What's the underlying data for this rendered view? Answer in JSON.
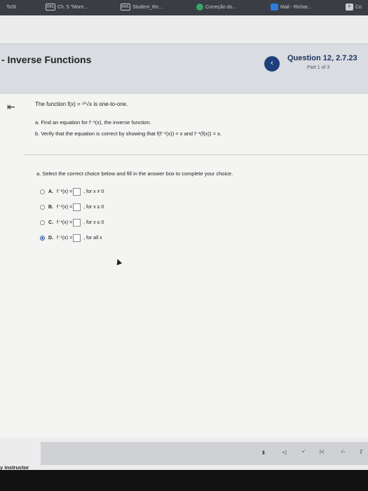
{
  "browser": {
    "tabs": [
      {
        "label": "ToSt",
        "icon": "tab-favicon"
      },
      {
        "label": "Ch. 5 \"More...",
        "icon": "mml-icon"
      },
      {
        "label": "Student_Re...",
        "icon": "mml-icon"
      },
      {
        "label": "Correção do...",
        "icon": "green-circle-icon"
      },
      {
        "label": "Mail - Richar...",
        "icon": "mail-icon"
      },
      {
        "label": "Co",
        "icon": "p-icon"
      }
    ]
  },
  "header": {
    "title": "- Inverse Functions",
    "question_title": "Question 12, 2.7.23",
    "question_sub": "Part 1 of 3",
    "nav_prev": "‹"
  },
  "problem": {
    "back": "⇤",
    "statement": "The function f(x) = ¹⁰√x is one-to-one.",
    "task_a": "a. Find an equation for f⁻¹(x), the inverse function.",
    "task_b": "b. Verify that the equation is correct by showing that f(f⁻¹(x)) = x and f⁻¹(f(x)) = x.",
    "instruction": "a. Select the correct choice below and fill in the answer box to complete your choice."
  },
  "choices": [
    {
      "letter": "A.",
      "lhs": "f⁻¹(x) =",
      "cond": ", for x ≠ 0",
      "selected": false
    },
    {
      "letter": "B.",
      "lhs": "f⁻¹(x) =",
      "cond": ", for x ≥ 0",
      "selected": false
    },
    {
      "letter": "C.",
      "lhs": "f⁻¹(x) =",
      "cond": ", for x ≤ 0",
      "selected": false
    },
    {
      "letter": "D.",
      "lhs": "f⁻¹(x) =",
      "cond": ", for all x",
      "selected": true
    }
  ],
  "toolbar": {
    "tools": [
      "▮",
      "▪▯",
      "▪'",
      "|▪|",
      "√▫",
      "∜"
    ]
  },
  "footer": {
    "instructor_text": "y instructor"
  }
}
